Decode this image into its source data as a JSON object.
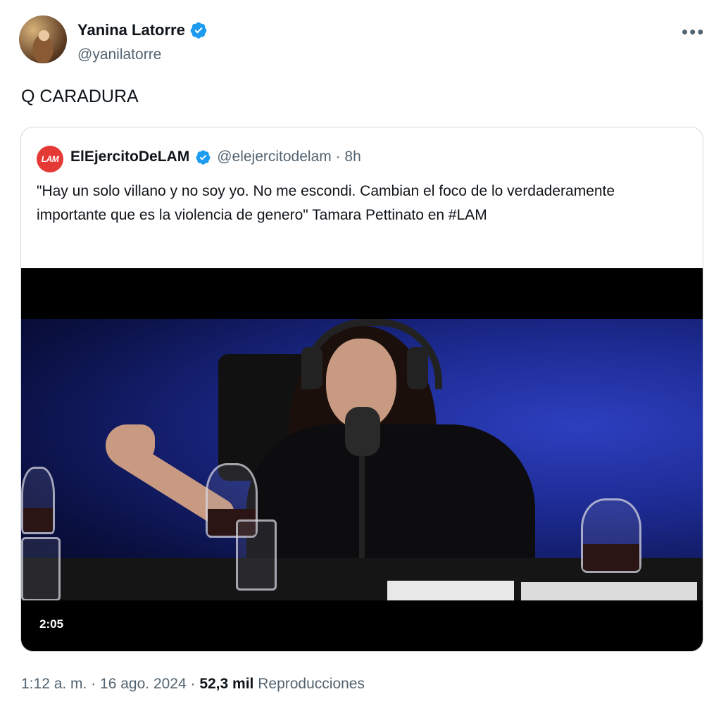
{
  "author": {
    "name": "Yanina Latorre",
    "handle": "@yanilatorre",
    "verified_color": "#1d9bf0"
  },
  "more_icon": "more-horizontal-icon",
  "tweet": {
    "text": "Q CARADURA"
  },
  "quoted": {
    "avatar_text": "LAM",
    "name": "ElEjercitoDeLAM",
    "handle_time": "@elejercitodelam · 8h",
    "text": "\"Hay un solo villano y no soy yo. No me escondi. Cambian el foco de lo verdaderamente importante que es la violencia de genero\" Tamara Pettinato en #LAM",
    "video": {
      "duration": "2:05"
    }
  },
  "footer": {
    "timestamp": "1:12 a. m. · 16 ago. 2024 · ",
    "views_count": "52,3 mil",
    "views_label": " Reproducciones"
  },
  "colors": {
    "accent": "#1d9bf0",
    "secondary_text": "#536471",
    "lam_red": "#e53935"
  }
}
